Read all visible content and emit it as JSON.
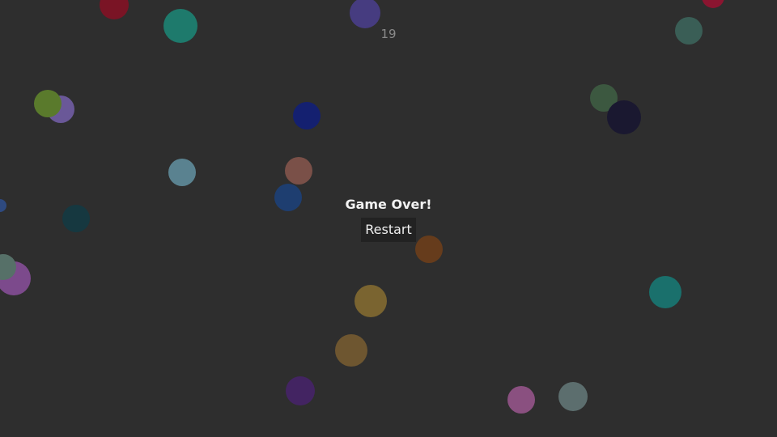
{
  "game": {
    "score": "19",
    "status_text": "Game Over!",
    "restart_label": "Restart",
    "background_color": "#2e2e2e",
    "balls": [
      {
        "color": "#7a1425"
      },
      {
        "color": "#1e7a6c"
      },
      {
        "color": "#463c80"
      },
      {
        "color": "#8a1530"
      },
      {
        "color": "#3a5e56"
      },
      {
        "color": "#6a5898"
      },
      {
        "color": "#5a7a2c"
      },
      {
        "color": "#142070"
      },
      {
        "color": "#3c5840"
      },
      {
        "color": "#1a1830"
      },
      {
        "color": "#5a8290"
      },
      {
        "color": "#7a5048"
      },
      {
        "color": "#1e3e70"
      },
      {
        "color": "#2e4a80"
      },
      {
        "color": "#163840"
      },
      {
        "color": "#7c4a8c"
      },
      {
        "color": "#567068"
      },
      {
        "color": "#663c1c"
      },
      {
        "color": "#1a706c"
      },
      {
        "color": "#7a6430"
      },
      {
        "color": "#6e5630"
      },
      {
        "color": "#432462"
      },
      {
        "color": "#8a5080"
      },
      {
        "color": "#5c6e6e"
      }
    ]
  }
}
